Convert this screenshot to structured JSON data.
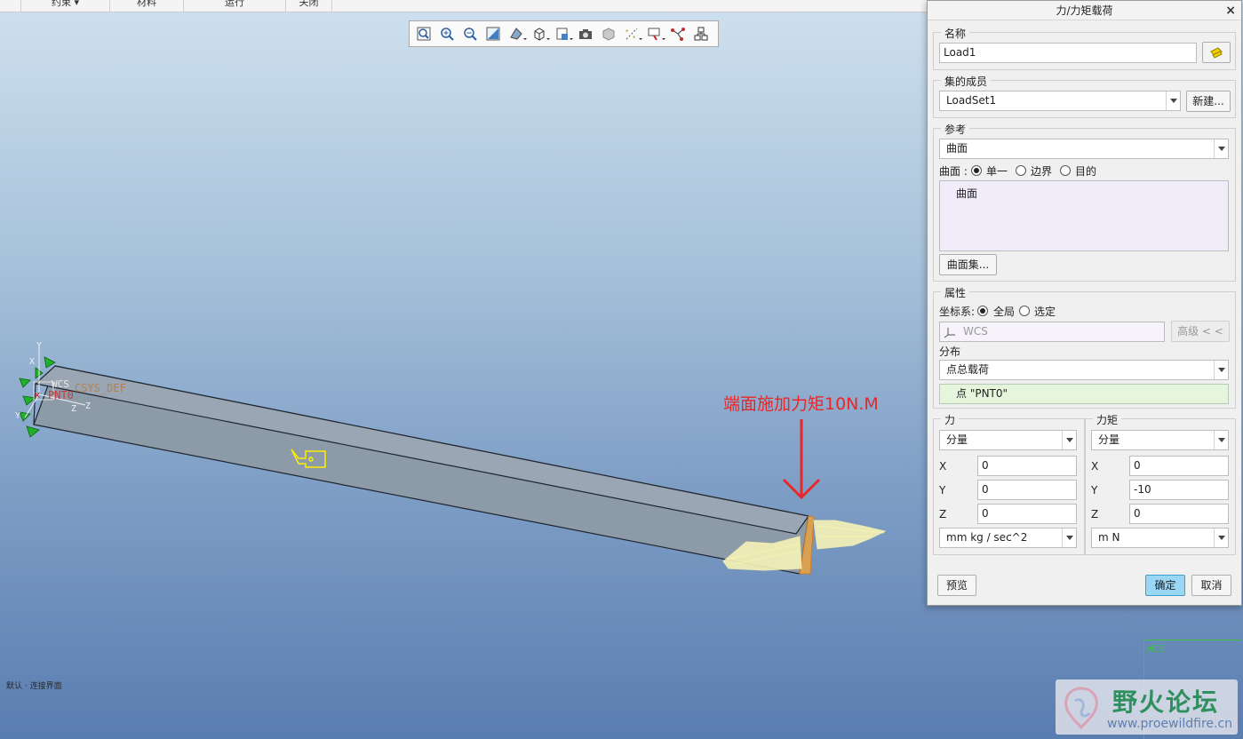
{
  "menubar": [
    "约束",
    "材料",
    "运行",
    "关闭"
  ],
  "toolbar": [
    "zoom-fit-icon",
    "zoom-in-icon",
    "zoom-out-icon",
    "repaint-icon",
    "view-orient-icon",
    "display-style-icon",
    "saved-views-icon",
    "camera-icon",
    "shaded-icon",
    "datum-display-icon",
    "annotation-icon",
    "sketch-icon",
    "assembly-icon"
  ],
  "viewport": {
    "annotation": "端面施加力矩10N.M",
    "csys_label": "CSYS_DEF",
    "point_label": "PNT0",
    "wcs_label": "WCS",
    "status_text": "默认 · 连接界面",
    "watermark_title": "野火论坛",
    "watermark_url": "www.proewildfire.cn"
  },
  "dialog": {
    "title": "力/力矩载荷",
    "close": "×",
    "name": {
      "legend": "名称",
      "value": "Load1"
    },
    "set": {
      "legend": "集的成员",
      "value": "LoadSet1",
      "new_btn": "新建..."
    },
    "ref": {
      "legend": "参考",
      "type": "曲面",
      "surface_label": "曲面 :",
      "opt_single": "单一",
      "opt_boundary": "边界",
      "opt_target": "目的",
      "list_item": "曲面",
      "set_btn": "曲面集..."
    },
    "props": {
      "legend": "属性",
      "csys_label": "坐标系:",
      "opt_global": "全局",
      "opt_selected": "选定",
      "csys_value": "WCS",
      "advanced_btn": "高级 < <",
      "dist_label": "分布",
      "dist_value": "点总载荷",
      "point_value": "点 \"PNT0\""
    },
    "force": {
      "legend": "力",
      "mode": "分量",
      "x_label": "X",
      "x": "0",
      "y_label": "Y",
      "y": "0",
      "z_label": "Z",
      "z": "0",
      "units": "mm kg / sec^2"
    },
    "moment": {
      "legend": "力矩",
      "mode": "分量",
      "x_label": "X",
      "x": "0",
      "y_label": "Y",
      "y": "-10",
      "z_label": "Z",
      "z": "0",
      "units": "m N"
    },
    "preview_btn": "预览",
    "ok_btn": "确定",
    "cancel_btn": "取消"
  },
  "colors": {
    "accent_button": "#99d7f5",
    "annotation": "#e8272a",
    "beam": "#8d9aa8",
    "load": "#f6f3b8"
  }
}
